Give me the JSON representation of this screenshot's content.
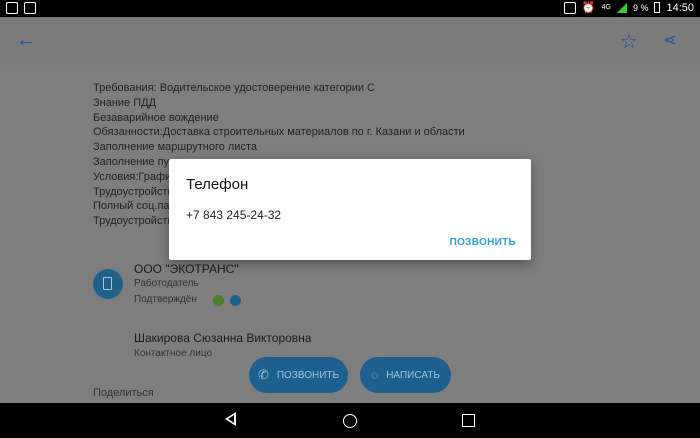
{
  "status": {
    "battery": "9 %",
    "time": "14:50",
    "network": "4G"
  },
  "details": {
    "lines": [
      "Требования: Водительское удостоверение категории С",
      "Знание ПДД",
      "Безаварийное вождение",
      "Обязанности:Доставка строительных материалов по г. Казани и области",
      "Заполнение маршрутного листа",
      "Заполнение пут",
      "Условия:График",
      "Трудоустройств",
      "Полный соц.пак",
      "Трудоустройств"
    ]
  },
  "employer": {
    "name": "ООО \"ЭКОТРАНС\"",
    "role": "Работодатель",
    "verified": "Подтверждён"
  },
  "contact": {
    "name": "Шакирова Сюзанна Викторовна",
    "role": "Контактное лицо"
  },
  "share_label": "Поделиться",
  "buttons": {
    "call": "ПОЗВОНИТЬ",
    "write": "НАПИСАТЬ"
  },
  "dialog": {
    "title": "Телефон",
    "phone": "+7 843 245-24-32",
    "action": "ПОЗВОНИТЬ"
  },
  "colors": {
    "accent": "#2aa3d8",
    "icon_blue": "#1a4f9a",
    "scrim": "#7e7e7e"
  }
}
